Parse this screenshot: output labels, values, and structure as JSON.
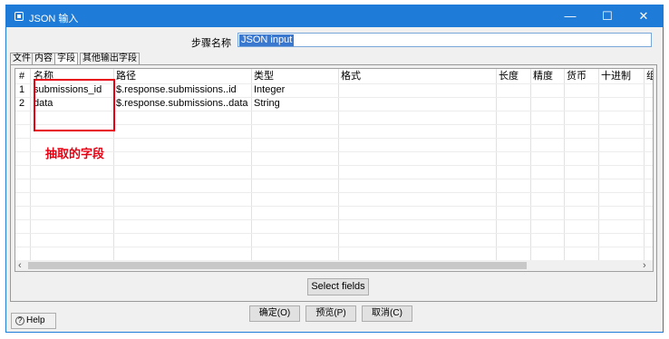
{
  "window": {
    "title": "JSON 输入",
    "min": "—",
    "max": "☐",
    "close": "✕"
  },
  "step": {
    "label": "步骤名称",
    "value": "JSON input"
  },
  "tabs": [
    "文件",
    "内容",
    "字段",
    "其他输出字段"
  ],
  "table": {
    "columns": [
      "#",
      "名称",
      "路径",
      "类型",
      "格式",
      "长度",
      "精度",
      "货币",
      "十进制",
      "组"
    ],
    "rows": [
      [
        "1",
        "submissions_id",
        "$.response.submissions..id",
        "Integer"
      ],
      [
        "2",
        "data",
        "$.response.submissions..data",
        "String"
      ]
    ]
  },
  "annotation": "抽取的字段",
  "buttons": {
    "select_fields": "Select fields",
    "ok": "确定(O)",
    "preview": "预览(P)",
    "cancel": "取消(C)",
    "help": "Help"
  },
  "colors": {
    "titlebar": "#1e7bd7",
    "annotation": "#e60012"
  }
}
